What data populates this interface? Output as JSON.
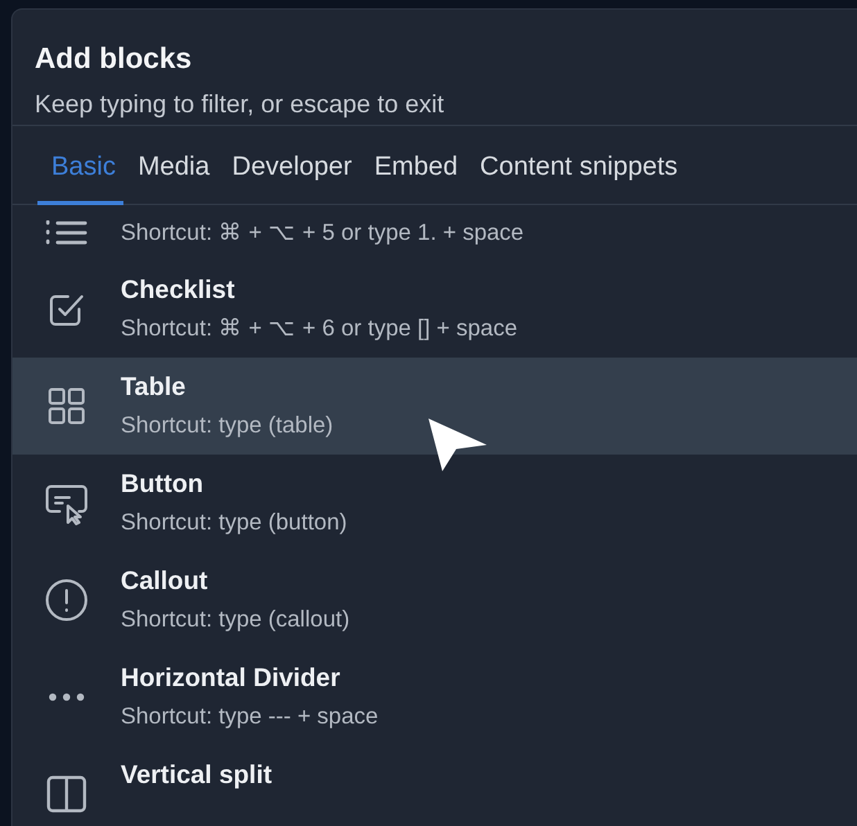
{
  "panel": {
    "title": "Add blocks",
    "subtitle": "Keep typing to filter, or escape to exit"
  },
  "tabs": [
    {
      "label": "Basic",
      "selected": true
    },
    {
      "label": "Media",
      "selected": false
    },
    {
      "label": "Developer",
      "selected": false
    },
    {
      "label": "Embed",
      "selected": false
    },
    {
      "label": "Content snippets",
      "selected": false
    }
  ],
  "blocks": [
    {
      "kind": "numbered-list",
      "shortcut": "Shortcut: ⌘ + ⌥ + 5 or type 1. + space",
      "selected": false
    },
    {
      "kind": "checklist",
      "title": "Checklist",
      "shortcut": "Shortcut: ⌘ + ⌥ + 6 or type [] + space",
      "selected": false
    },
    {
      "kind": "table",
      "title": "Table",
      "shortcut": "Shortcut: type (table)",
      "selected": true
    },
    {
      "kind": "button",
      "title": "Button",
      "shortcut": "Shortcut: type (button)",
      "selected": false
    },
    {
      "kind": "callout",
      "title": "Callout",
      "shortcut": "Shortcut: type (callout)",
      "selected": false
    },
    {
      "kind": "divider",
      "title": "Horizontal Divider",
      "shortcut": "Shortcut: type --- + space",
      "selected": false
    },
    {
      "kind": "split",
      "title": "Vertical split",
      "selected": false
    }
  ]
}
